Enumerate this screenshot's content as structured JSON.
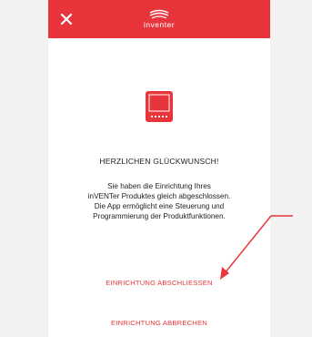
{
  "header": {
    "brand": "inventer",
    "color": "#e8353b"
  },
  "icons": {
    "close": "close-icon",
    "device": "device-display-icon",
    "logo": "inventer-logo-icon"
  },
  "main": {
    "title": "HERZLICHEN GLÜCKWUNSCH!",
    "message": "Sie haben die Einrichtung Ihres\ninVENTer Produktes gleich abgeschlossen.\nDie App ermöglicht eine Steuerung und\nProgrammierung der Produktfunktionen."
  },
  "actions": {
    "complete_label": "EINRICHTUNG ABSCHLIESSEN",
    "cancel_label": "EINRICHTUNG ABBRECHEN"
  },
  "annotation": {
    "arrow_color": "#e8353b"
  }
}
